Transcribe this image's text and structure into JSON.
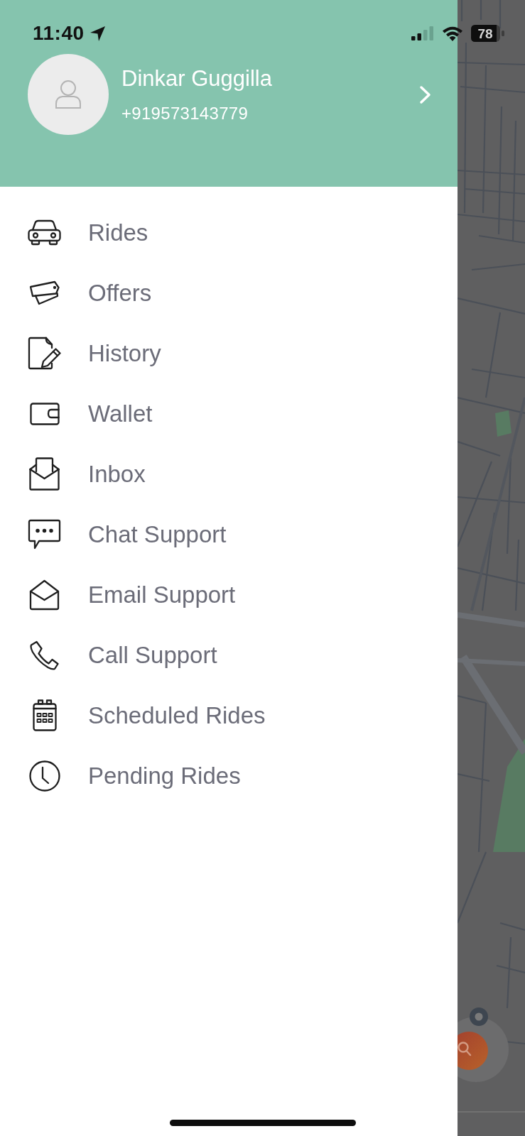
{
  "status_bar": {
    "time": "11:40",
    "battery": "78"
  },
  "profile": {
    "name": "Dinkar Guggilla",
    "phone": "+919573143779"
  },
  "menu": [
    "Rides",
    "Offers",
    "History",
    "Wallet",
    "Inbox",
    "Chat Support",
    "Email Support",
    "Call Support",
    "Scheduled Rides",
    "Pending Rides"
  ]
}
